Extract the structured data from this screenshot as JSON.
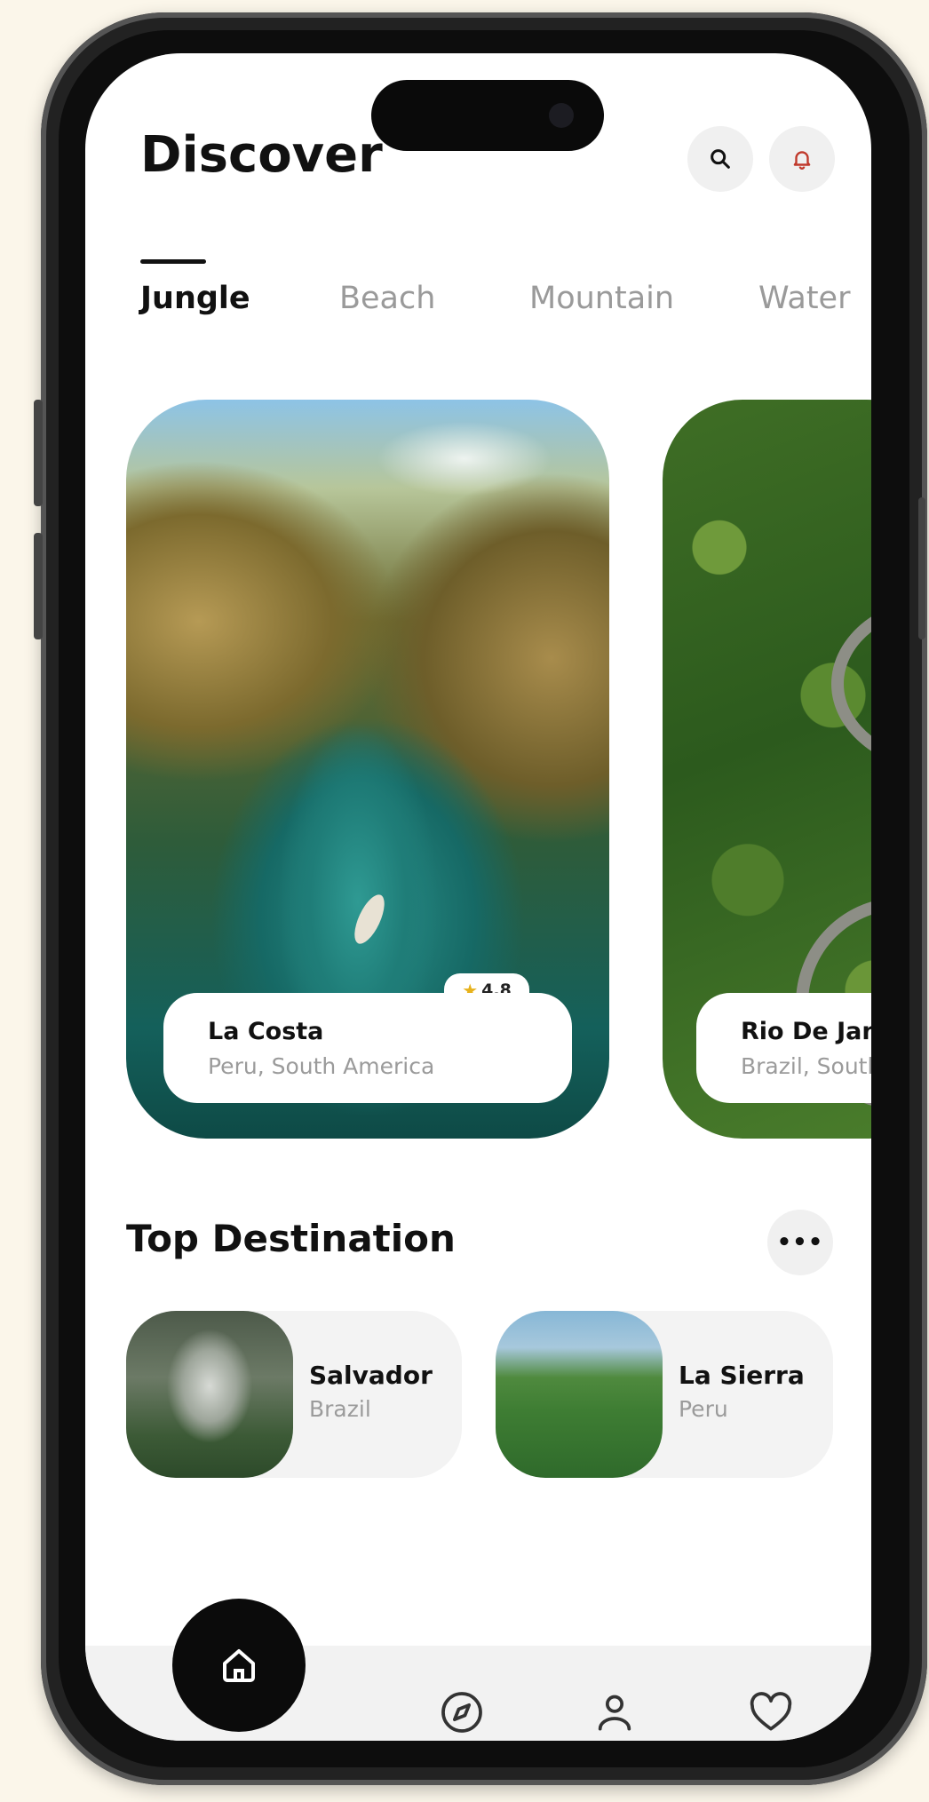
{
  "header": {
    "title": "Discover",
    "search_icon": "search-icon",
    "notification_icon": "bell-icon"
  },
  "tabs": [
    {
      "label": "Jungle",
      "active": true
    },
    {
      "label": "Beach",
      "active": false
    },
    {
      "label": "Mountain",
      "active": false
    },
    {
      "label": "Water",
      "active": false
    }
  ],
  "featured": [
    {
      "name": "La Costa",
      "location": "Peru, South America",
      "rating": "4.8"
    },
    {
      "name": "Rio De Janeiro",
      "location": "Brazil, South America"
    }
  ],
  "top_destination": {
    "title": "Top Destination",
    "more_icon": "more-icon",
    "items": [
      {
        "name": "Salvador",
        "country": "Brazil"
      },
      {
        "name": "La Sierra",
        "country": "Peru"
      }
    ]
  },
  "bottom_nav": {
    "items": [
      "home-icon",
      "compass-icon",
      "profile-icon",
      "heart-icon"
    ],
    "active": "home-icon"
  },
  "colors": {
    "background": "#fbf6ea",
    "accent": "#0b0b0b",
    "rating_star": "#e7b21c"
  }
}
